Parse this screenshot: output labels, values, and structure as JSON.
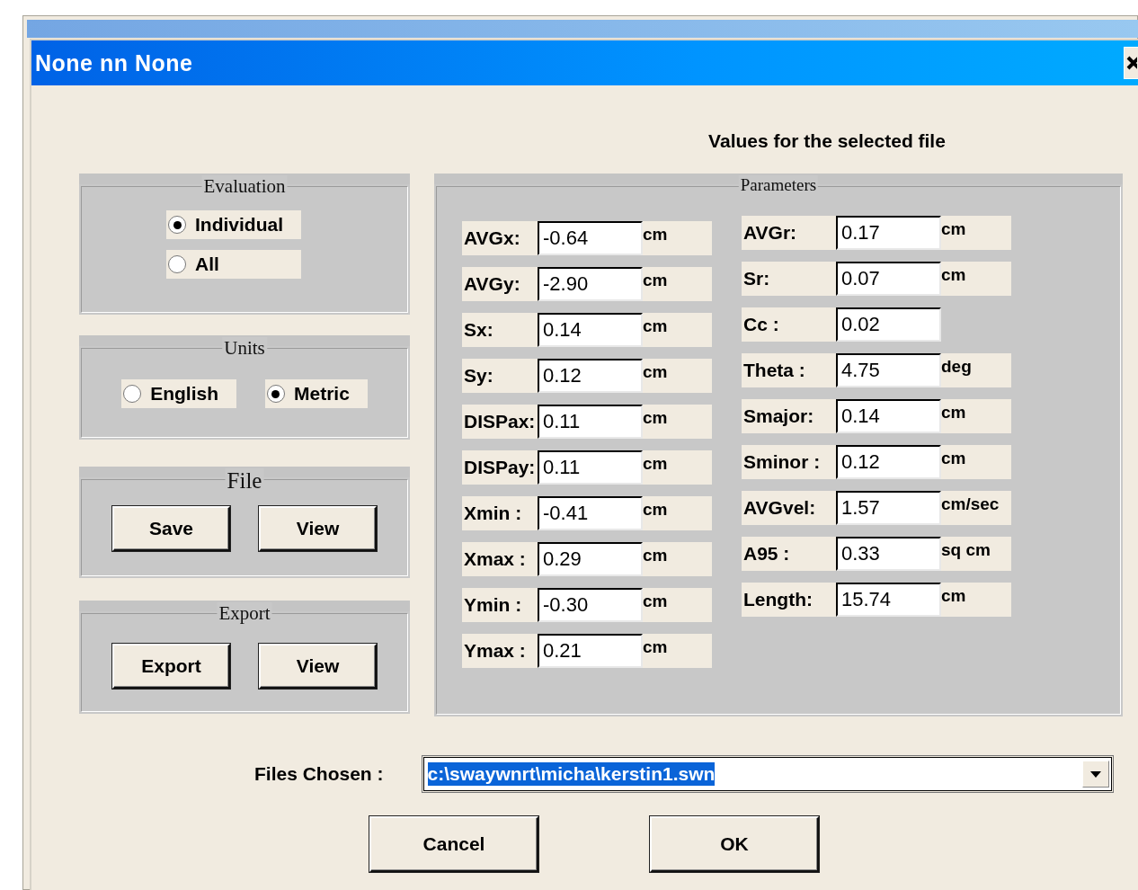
{
  "window": {
    "title": "None nn None"
  },
  "heading": "Values for the selected file",
  "evaluation": {
    "legend": "Evaluation",
    "options": [
      {
        "label": "Individual",
        "selected": true
      },
      {
        "label": "All",
        "selected": false
      }
    ]
  },
  "units": {
    "legend": "Units",
    "options": [
      {
        "label": "English",
        "selected": false
      },
      {
        "label": "Metric",
        "selected": true
      }
    ]
  },
  "file": {
    "legend": "File",
    "buttons": [
      {
        "label": "Save"
      },
      {
        "label": "View"
      }
    ]
  },
  "export": {
    "legend": "Export",
    "buttons": [
      {
        "label": "Export"
      },
      {
        "label": "View"
      }
    ]
  },
  "parameters": {
    "legend": "Parameters",
    "left": [
      {
        "label": "AVGx:",
        "value": "-0.64",
        "unit": "cm"
      },
      {
        "label": "AVGy:",
        "value": "-2.90",
        "unit": "cm"
      },
      {
        "label": "Sx:",
        "value": "0.14",
        "unit": "cm"
      },
      {
        "label": "Sy:",
        "value": "0.12",
        "unit": "cm"
      },
      {
        "label": "DISPax:",
        "value": "0.11",
        "unit": "cm"
      },
      {
        "label": "DISPay:",
        "value": "0.11",
        "unit": "cm"
      },
      {
        "label": "Xmin :",
        "value": "-0.41",
        "unit": "cm"
      },
      {
        "label": "Xmax :",
        "value": "0.29",
        "unit": "cm"
      },
      {
        "label": "Ymin :",
        "value": "-0.30",
        "unit": "cm"
      },
      {
        "label": "Ymax :",
        "value": "0.21",
        "unit": "cm"
      }
    ],
    "right": [
      {
        "label": "AVGr:",
        "value": "0.17",
        "unit": "cm"
      },
      {
        "label": "Sr:",
        "value": "0.07",
        "unit": "cm"
      },
      {
        "label": "Cc :",
        "value": "0.02"
      },
      {
        "label": "Theta :",
        "value": "4.75",
        "unit": "deg"
      },
      {
        "label": "Smajor:",
        "value": "0.14",
        "unit": "cm"
      },
      {
        "label": "Sminor :",
        "value": "0.12",
        "unit": "cm"
      },
      {
        "label": "AVGvel:",
        "value": "1.57",
        "unit": "cm/sec"
      },
      {
        "label": "A95 :",
        "value": "0.33",
        "unit": "sq cm"
      },
      {
        "label": "Length:",
        "value": "15.74",
        "unit": "cm"
      }
    ]
  },
  "files_chosen": {
    "label": "Files Chosen :",
    "value": "c:\\swaywnrt\\micha\\kerstin1.swn"
  },
  "buttons": [
    {
      "label": "Cancel"
    },
    {
      "label": "OK"
    }
  ]
}
